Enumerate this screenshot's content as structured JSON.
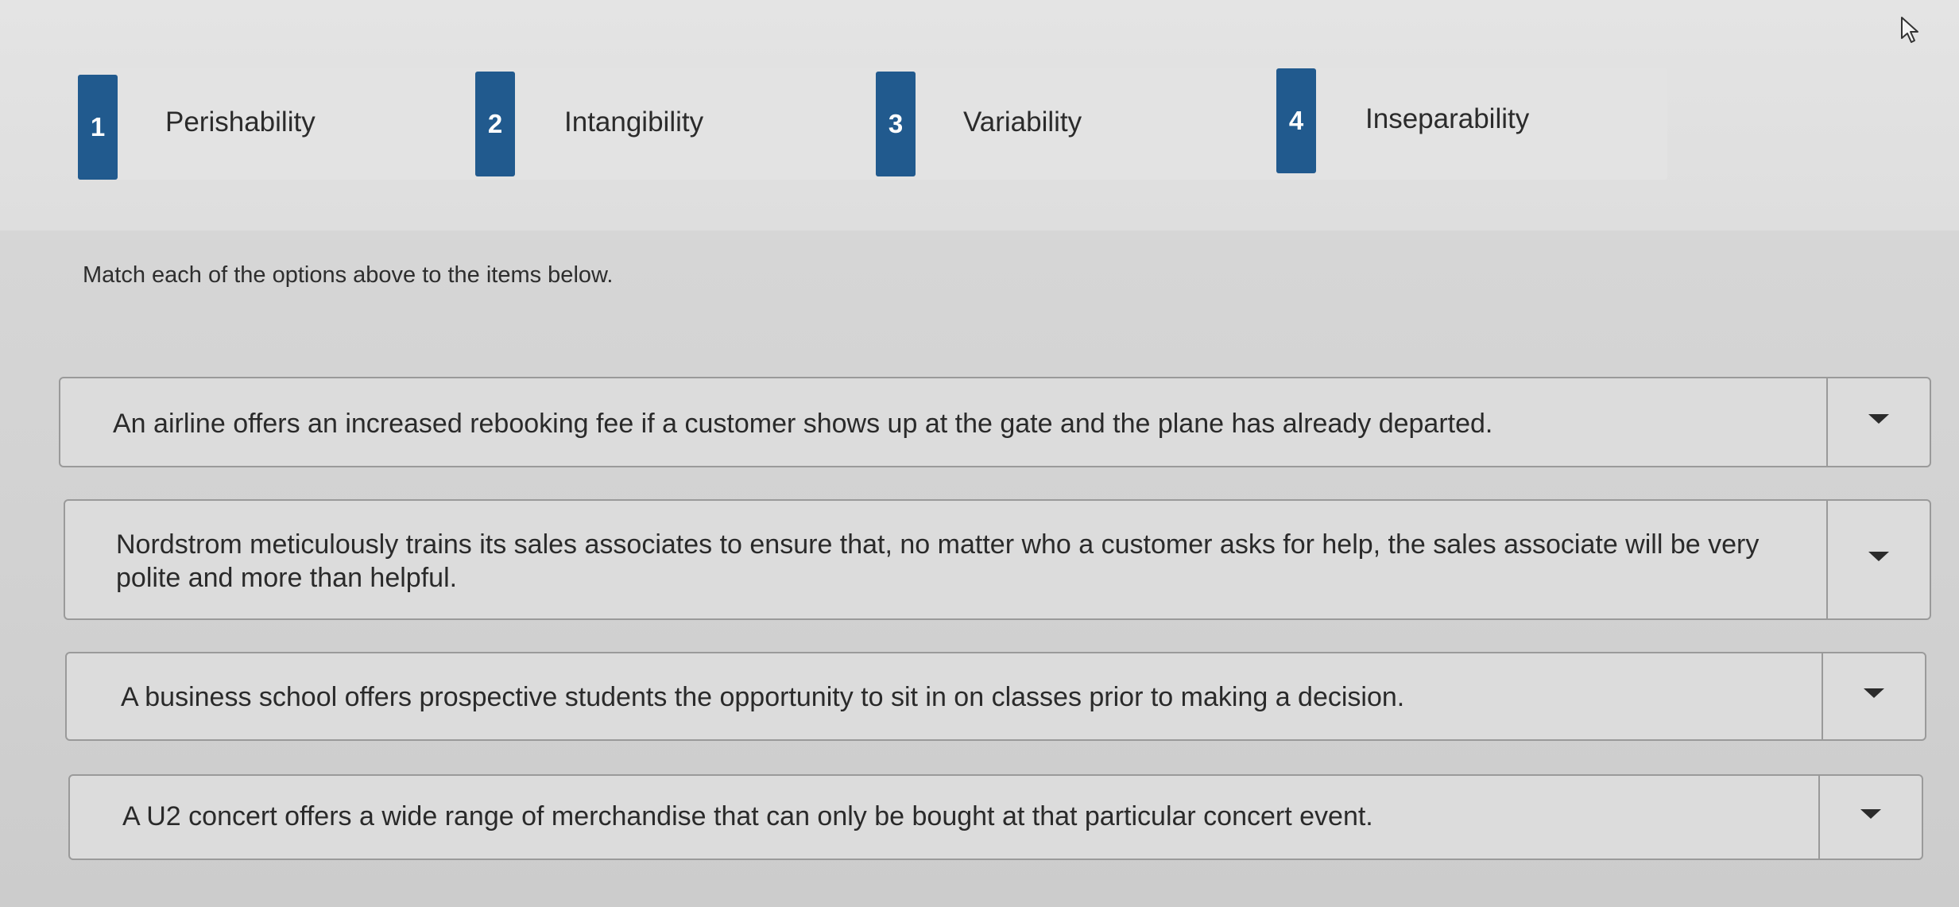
{
  "options": [
    {
      "number": "1",
      "label": "Perishability"
    },
    {
      "number": "2",
      "label": "Intangibility"
    },
    {
      "number": "3",
      "label": "Variability"
    },
    {
      "number": "4",
      "label": "Inseparability"
    }
  ],
  "instructions": "Match each of the options above to the items below.",
  "items": [
    {
      "text": "An airline offers an increased rebooking fee if a customer shows up at the gate and the plane has already departed.",
      "selected": ""
    },
    {
      "text": "Nordstrom meticulously trains its sales associates to ensure that, no matter who a customer asks for help, the sales associate will be very polite and more than helpful.",
      "selected": ""
    },
    {
      "text": "A business school offers prospective students the opportunity to sit in on classes prior to making a decision.",
      "selected": ""
    },
    {
      "text": "A U2 concert offers a wide range of merchandise that can only be bought at that particular concert event.",
      "selected": ""
    }
  ],
  "colors": {
    "badge": "#215a8e",
    "background": "#d6d6d6",
    "border": "#9a9a9a"
  },
  "icons": {
    "dropdown": "caret-down-icon",
    "cursor": "mouse-pointer-icon"
  }
}
